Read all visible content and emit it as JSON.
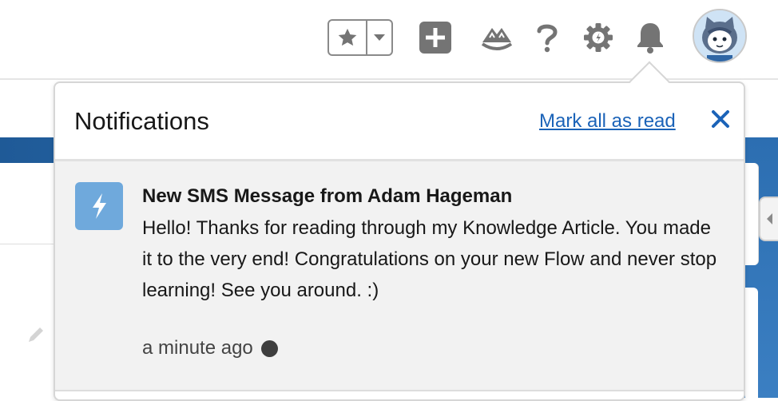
{
  "colors": {
    "header_icon": "#747474",
    "link": "#1b63b8",
    "notif_icon_bg": "#6fa9dc",
    "banner": "#2d6fb3",
    "unread_dot": "#3e3e3e"
  },
  "header": {
    "icons": [
      "favorite-star-icon",
      "favorites-dropdown-icon",
      "global-create-icon",
      "trailhead-icon",
      "help-icon",
      "setup-gear-icon",
      "notifications-bell-icon",
      "user-avatar"
    ]
  },
  "notifications": {
    "title": "Notifications",
    "mark_all_label": "Mark all as read",
    "close_icon": "close-icon",
    "items": [
      {
        "icon": "lightning-bolt-icon",
        "title": "New SMS Message from Adam Hageman",
        "body": "Hello! Thanks for reading through my Knowledge Article. You made it to the very end! Congratulations on your new Flow and never stop learning! See you around. :)",
        "time": "a minute ago",
        "unread": true
      }
    ]
  }
}
